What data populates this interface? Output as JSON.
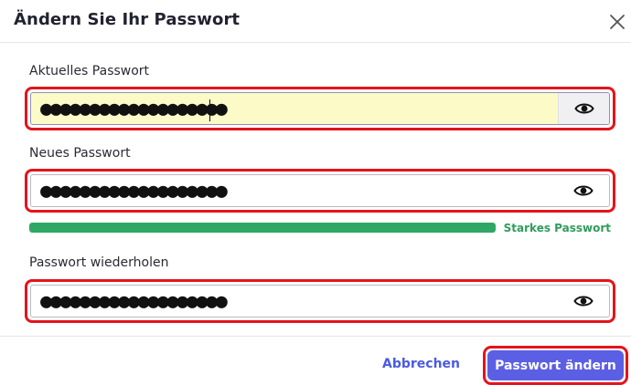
{
  "dialog": {
    "title": "Ändern Sie Ihr Passwort",
    "close_icon": "close-icon"
  },
  "fields": {
    "current": {
      "label": "Aktuelles Passwort",
      "value": "●●●●●●●●●●●●●●●●●●●",
      "toggle_icon": "eye-icon"
    },
    "new": {
      "label": "Neues Passwort",
      "value": "●●●●●●●●●●●●●●●●●●●",
      "toggle_icon": "eye-icon"
    },
    "repeat": {
      "label": "Passwort wiederholen",
      "value": "●●●●●●●●●●●●●●●●●●●",
      "toggle_icon": "eye-icon"
    }
  },
  "strength": {
    "label": "Starkes Passwort",
    "level_percent": 100,
    "color": "#2fa866"
  },
  "footer": {
    "cancel_label": "Abbrechen",
    "submit_label": "Passwort ändern"
  },
  "colors": {
    "accent": "#5b5fe3",
    "error_outline": "#e4141b",
    "success": "#2f9d5c",
    "autofill_bg": "#fcfbc8"
  }
}
